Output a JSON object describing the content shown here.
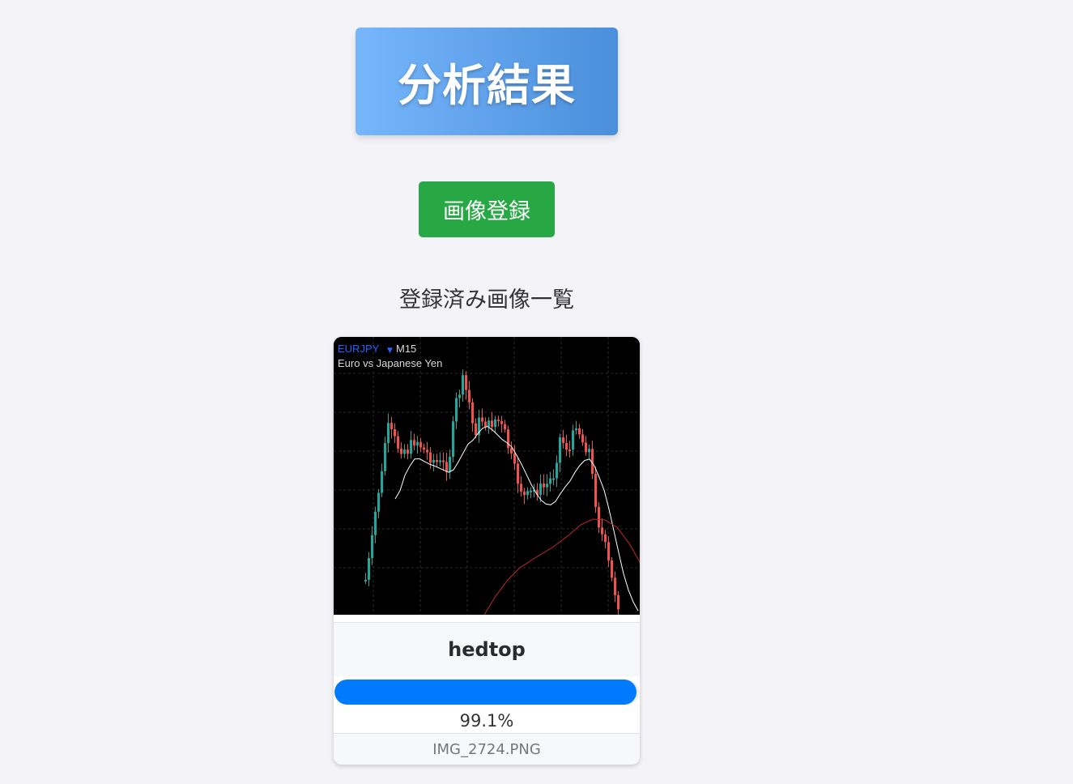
{
  "header": {
    "title": "分析結果"
  },
  "actions": {
    "register_label": "画像登録"
  },
  "gallery": {
    "title": "登録済み画像一覧",
    "items": [
      {
        "chart": {
          "symbol": "EURJPY",
          "timeframe": "M15",
          "description": "Euro vs Japanese Yen"
        },
        "pattern": "hedtop",
        "confidence_label": "99.1%",
        "confidence": 0.991,
        "filename": "IMG_2724.PNG"
      }
    ]
  },
  "colors": {
    "header_gradient_start": "#77b6fb",
    "header_gradient_end": "#4a8fdc",
    "register_button": "#28a745",
    "progress_fill": "#007bff",
    "candle_up": "#26a69a",
    "candle_down": "#ef5350",
    "symbol_text": "#2962ff"
  }
}
